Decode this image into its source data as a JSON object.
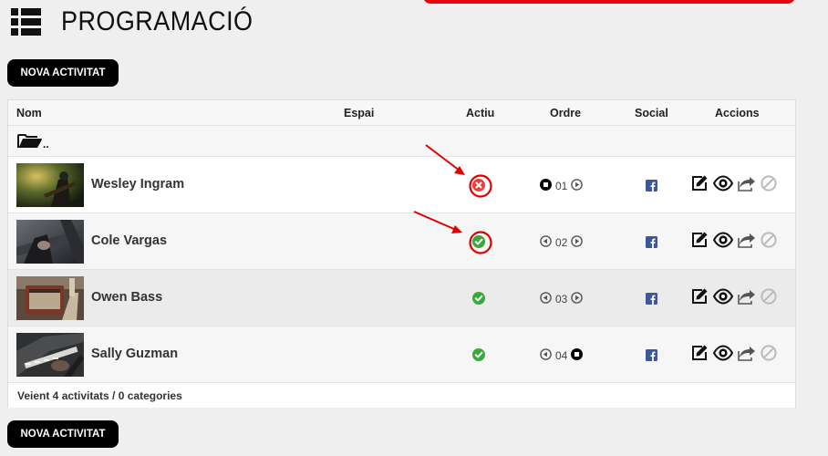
{
  "page": {
    "title": "PROGRAMACIÓ"
  },
  "toolbar": {
    "new_activity_label": "NOVA ACTIVITAT"
  },
  "table": {
    "columns": {
      "name": "Nom",
      "space": "Espai",
      "active": "Actiu",
      "order": "Ordre",
      "social": "Social",
      "actions": "Accions"
    },
    "folder_up_label": "..",
    "rows": [
      {
        "name": "Wesley Ingram",
        "active": false,
        "order": "01",
        "order_prev": "stop",
        "order_next": "play",
        "social": "facebook"
      },
      {
        "name": "Cole Vargas",
        "active": true,
        "order": "02",
        "order_prev": "play",
        "order_next": "play",
        "social": "facebook"
      },
      {
        "name": "Owen Bass",
        "active": true,
        "order": "03",
        "order_prev": "play",
        "order_next": "play",
        "social": "facebook"
      },
      {
        "name": "Sally Guzman",
        "active": true,
        "order": "04",
        "order_prev": "play",
        "order_next": "stop",
        "social": "facebook"
      }
    ],
    "footer": "Veient 4 activitats / 0 categories"
  },
  "icons": {
    "header": "list-icon",
    "folder": "folder-open-icon",
    "inactive": "x-circle-icon",
    "active": "check-circle-icon",
    "order_stop": "stop-circle-icon",
    "order_play": "play-circle-icon",
    "social": "facebook-icon",
    "actions": [
      "edit-icon",
      "view-icon",
      "share-icon",
      "disable-icon"
    ]
  },
  "colors": {
    "accent": "#e30613",
    "active_green": "#3aa83a",
    "inactive_red": "#e8403c",
    "facebook_blue": "#3b5998",
    "annotation_red": "#e00000",
    "button_bg": "#000000"
  }
}
